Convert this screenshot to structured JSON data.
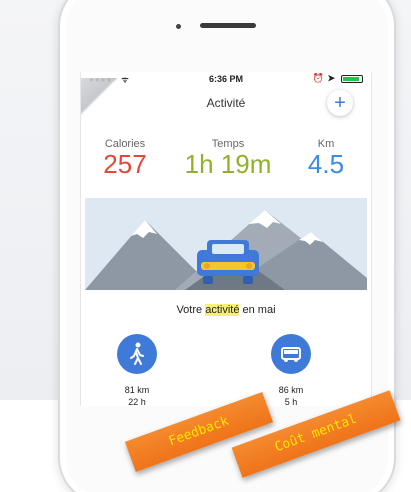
{
  "statusbar": {
    "signal": "●●●●○ ᯤ",
    "time": "6:36 PM",
    "alarm": "⏰",
    "arrow": "➤"
  },
  "header": {
    "title": "Activité",
    "add_label": "+"
  },
  "stats": {
    "calories": {
      "label": "Calories",
      "value": "257"
    },
    "time": {
      "label": "Temps",
      "value": "1h 19m"
    },
    "km": {
      "label": "Km",
      "value": "4.5"
    }
  },
  "summary": {
    "prefix": "Votre ",
    "highlight": "activité",
    "suffix": " en mai"
  },
  "activities": [
    {
      "icon": "walking-icon",
      "distance": "81 km",
      "duration": "22 h"
    },
    {
      "icon": "car-icon",
      "distance": "86 km",
      "duration": "5 h"
    }
  ],
  "tags": {
    "feedback": "Feedback",
    "cout": "Coût mental"
  },
  "colors": {
    "calories": "#e1483a",
    "time": "#8fb22a",
    "km": "#3b8be0",
    "accent_blue": "#3f7ad8",
    "tag_orange": "#ef7319",
    "tag_text": "#ffe600"
  }
}
